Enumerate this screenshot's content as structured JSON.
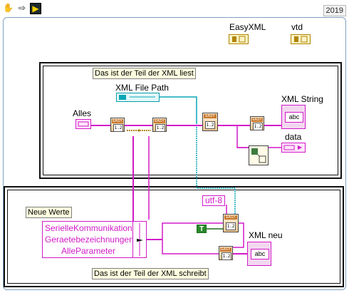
{
  "toolbar": {
    "hand_icon": "hand-icon",
    "arrow_icon": "run-arrow-icon",
    "run_icon": "run-continuously-icon",
    "version": "2019"
  },
  "top_labels": {
    "easyxml": "EasyXML",
    "vtd": "vtd"
  },
  "read_frame": {
    "comment": "Das ist der Teil der XML liest",
    "xml_file_path": "XML File Path",
    "alles": "Alles",
    "xml_string": "XML String",
    "data": "data"
  },
  "write_frame": {
    "comment": "Das ist der Teil der XML schreibt",
    "neue_werte": "Neue Werte",
    "items": [
      "SerielleKommunikation",
      "Geraetebezeichnungen",
      "AlleParameter"
    ],
    "encoding": "utf-8",
    "bool_constant": "T",
    "xml_neu": "XML neu"
  },
  "vi_glyphs": {
    "header": "EASY",
    "number": "1.2"
  },
  "indicator_text": "abc",
  "colors": {
    "pink_wire": "#d21ac9",
    "teal_wire": "#0aa6b5",
    "frame_border": "#111111",
    "outer_border": "#7fa1c2",
    "comment_bg": "#ffffe0"
  }
}
